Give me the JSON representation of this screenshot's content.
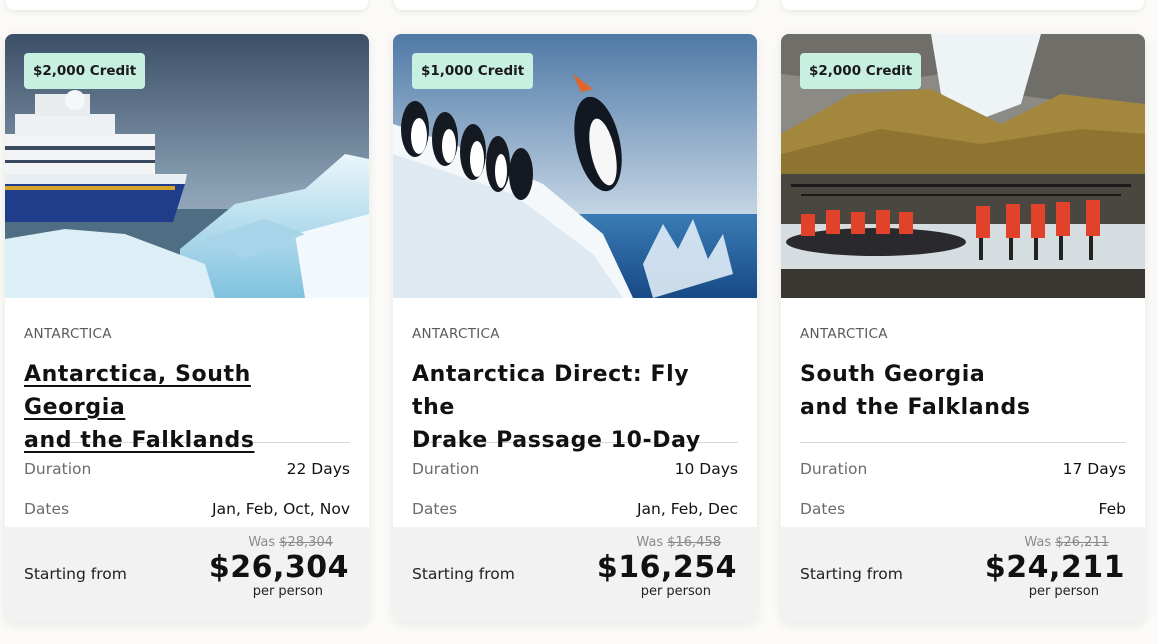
{
  "cards": [
    {
      "credit": "$2,000 Credit",
      "region": "ANTARCTICA",
      "title": "Antarctica, South Georgia\nand the Falklands",
      "duration_label": "Duration",
      "duration": "22 Days",
      "dates_label": "Dates",
      "dates": "Jan, Feb, Oct, Nov",
      "starting_label": "Starting from",
      "was_label": "Was",
      "was_price": "$28,304",
      "price": "$26,304",
      "per": "per person",
      "image": "expedition-ship-among-icebergs"
    },
    {
      "credit": "$1,000 Credit",
      "region": "ANTARCTICA",
      "title": "Antarctica Direct: Fly the\nDrake Passage 10-Day",
      "duration_label": "Duration",
      "duration": "10 Days",
      "dates_label": "Dates",
      "dates": "Jan, Feb, Dec",
      "starting_label": "Starting from",
      "was_label": "Was",
      "was_price": "$16,458",
      "price": "$16,254",
      "per": "per person",
      "image": "penguins-jumping-from-ice"
    },
    {
      "credit": "$2,000 Credit",
      "region": "ANTARCTICA",
      "title": "South Georgia\nand the Falklands",
      "duration_label": "Duration",
      "duration": "17 Days",
      "dates_label": "Dates",
      "dates": "Feb",
      "starting_label": "Starting from",
      "was_label": "Was",
      "was_price": "$26,211",
      "price": "$24,211",
      "per": "per person",
      "image": "zodiac-landing-with-king-penguins"
    }
  ],
  "colors": {
    "badge_bg": "#c8f0e0",
    "price_box_bg": "#f2f2f2",
    "page_bg": "#fbfaf7"
  }
}
